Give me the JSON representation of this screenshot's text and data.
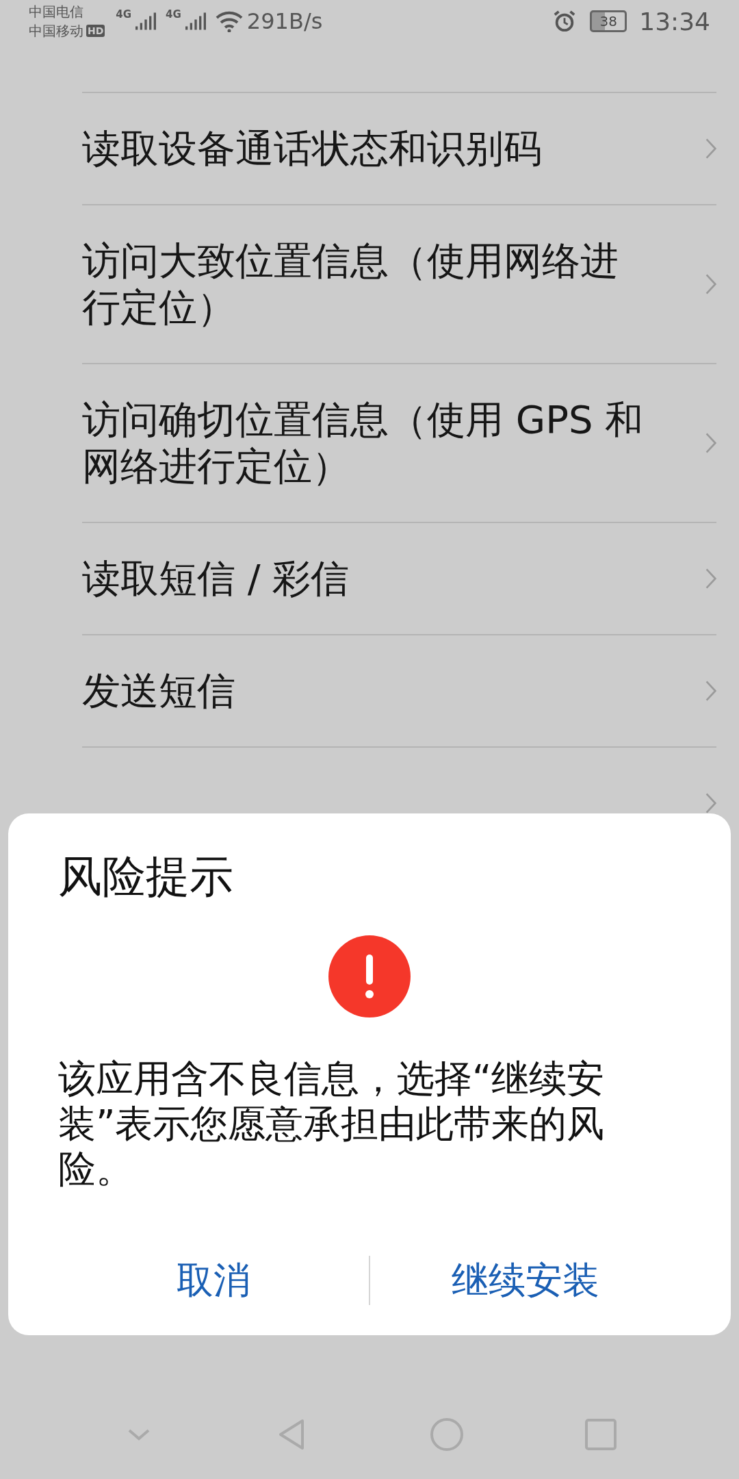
{
  "status_bar": {
    "carrier_1": "中国电信",
    "carrier_2": "中国移动",
    "hd_badge": "HD",
    "network_1": "4G",
    "network_2": "4G",
    "speed": "291B/s",
    "battery": "38",
    "time": "13:34"
  },
  "permissions": [
    {
      "label": "读取设备通话状态和识别码"
    },
    {
      "label": "访问大致位置信息（使用网络进行定位）"
    },
    {
      "label": "访问确切位置信息（使用 GPS 和网络进行定位）"
    },
    {
      "label": "读取短信 / 彩信"
    },
    {
      "label": "发送短信"
    }
  ],
  "dialog": {
    "title": "风险提示",
    "message": "该应用含不良信息，选择“继续安装”表示您愿意承担由此带来的风险。",
    "buttons": [
      "取消",
      "继续安装"
    ]
  }
}
